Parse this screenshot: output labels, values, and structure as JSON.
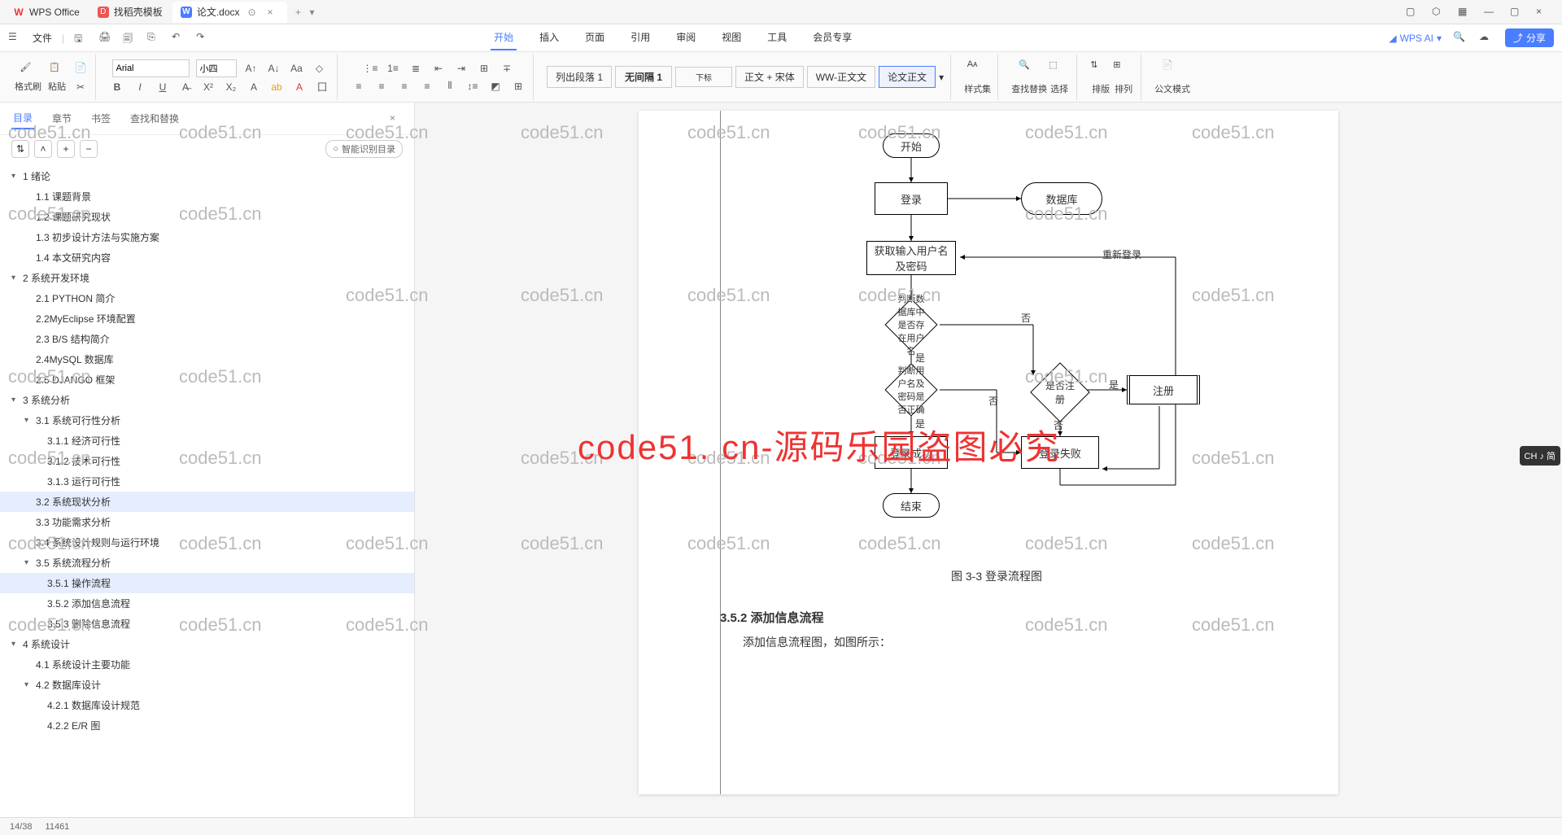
{
  "titleBar": {
    "tabs": [
      {
        "icon": "W",
        "iconColor": "#e33",
        "label": "WPS Office"
      },
      {
        "icon": "D",
        "iconColor": "#e55",
        "label": "找稻壳模板"
      },
      {
        "icon": "W",
        "iconColor": "#4a7dff",
        "label": "论文.docx",
        "active": true
      }
    ]
  },
  "menuBar": {
    "fileLabel": "文件",
    "tabs": [
      "开始",
      "插入",
      "页面",
      "引用",
      "审阅",
      "视图",
      "工具",
      "会员专享"
    ],
    "activeTab": "开始",
    "aiLabel": "WPS AI",
    "shareLabel": "分享"
  },
  "ribbon": {
    "formatBrush": "格式刷",
    "paste": "粘贴",
    "fontName": "Arial",
    "fontSize": "小四",
    "styles": [
      "列出段落 1",
      "无间隔 1",
      "下标",
      "正文 + 宋体",
      "WW-正文文",
      "论文正文"
    ],
    "activeStyle": "论文正文",
    "styleSet": "样式集",
    "findReplace": "查找替换",
    "select": "选择",
    "sort": "排版",
    "arrange": "排列",
    "officialMode": "公文模式"
  },
  "leftPanel": {
    "tabs": [
      "目录",
      "章节",
      "书签",
      "查找和替换"
    ],
    "activeTab": "目录",
    "smartOutline": "智能识别目录",
    "tooltip": "3.2 系统现状分析",
    "outline": [
      {
        "lvl": 1,
        "txt": "1 绪论",
        "caret": true
      },
      {
        "lvl": 2,
        "txt": "1.1 课题背景"
      },
      {
        "lvl": 2,
        "txt": "1.2 课题研究现状"
      },
      {
        "lvl": 2,
        "txt": "1.3 初步设计方法与实施方案"
      },
      {
        "lvl": 2,
        "txt": "1.4 本文研究内容"
      },
      {
        "lvl": 1,
        "txt": "2 系统开发环境",
        "caret": true
      },
      {
        "lvl": 2,
        "txt": "2.1 PYTHON 简介"
      },
      {
        "lvl": 2,
        "txt": "2.2MyEclipse 环境配置"
      },
      {
        "lvl": 2,
        "txt": "2.3 B/S 结构简介"
      },
      {
        "lvl": 2,
        "txt": "2.4MySQL 数据库"
      },
      {
        "lvl": 2,
        "txt": "2.5 DJANGO 框架"
      },
      {
        "lvl": 1,
        "txt": "3 系统分析",
        "caret": true
      },
      {
        "lvl": 2,
        "txt": "3.1 系统可行性分析",
        "caret": true
      },
      {
        "lvl": 3,
        "txt": "3.1.1 经济可行性"
      },
      {
        "lvl": 3,
        "txt": "3.1.2 技术可行性"
      },
      {
        "lvl": 3,
        "txt": "3.1.3 运行可行性"
      },
      {
        "lvl": 2,
        "txt": "3.2 系统现状分析",
        "sel": true
      },
      {
        "lvl": 2,
        "txt": "3.3 功能需求分析"
      },
      {
        "lvl": 2,
        "txt": "3.4 系统设计规则与运行环境"
      },
      {
        "lvl": 2,
        "txt": "3.5 系统流程分析",
        "caret": true
      },
      {
        "lvl": 3,
        "txt": "3.5.1 操作流程",
        "sel": true
      },
      {
        "lvl": 3,
        "txt": "3.5.2 添加信息流程"
      },
      {
        "lvl": 3,
        "txt": "3.5.3 删除信息流程"
      },
      {
        "lvl": 1,
        "txt": "4 系统设计",
        "caret": true
      },
      {
        "lvl": 2,
        "txt": "4.1 系统设计主要功能"
      },
      {
        "lvl": 2,
        "txt": "4.2 数据库设计",
        "caret": true
      },
      {
        "lvl": 3,
        "txt": "4.2.1 数据库设计规范"
      },
      {
        "lvl": 3,
        "txt": "4.2.2 E/R 图"
      }
    ]
  },
  "doc": {
    "flow": {
      "start": "开始",
      "login": "登录",
      "db": "数据库",
      "getInput": "获取输入用户名及密码",
      "relogin": "重新登录",
      "checkDb": "判断数据库中是否存在用户名",
      "checkPwd": "判断用户名及密码是否正确",
      "isRegister": "是否注册",
      "register": "注册",
      "loginOk": "登录成功",
      "loginFail": "登录失败",
      "end": "结束",
      "yes": "是",
      "no": "否"
    },
    "caption": "图 3-3 登录流程图",
    "section": "3.5.2 添加信息流程",
    "para1": "添加信息流程图，如图所示："
  },
  "bigWatermark": "code51. cn-源码乐园盗图必究",
  "smallWatermark": "code51.cn",
  "rightFloat": "CH ♪ 简",
  "statusBar": {
    "page": "14/38",
    "words": "11461"
  }
}
